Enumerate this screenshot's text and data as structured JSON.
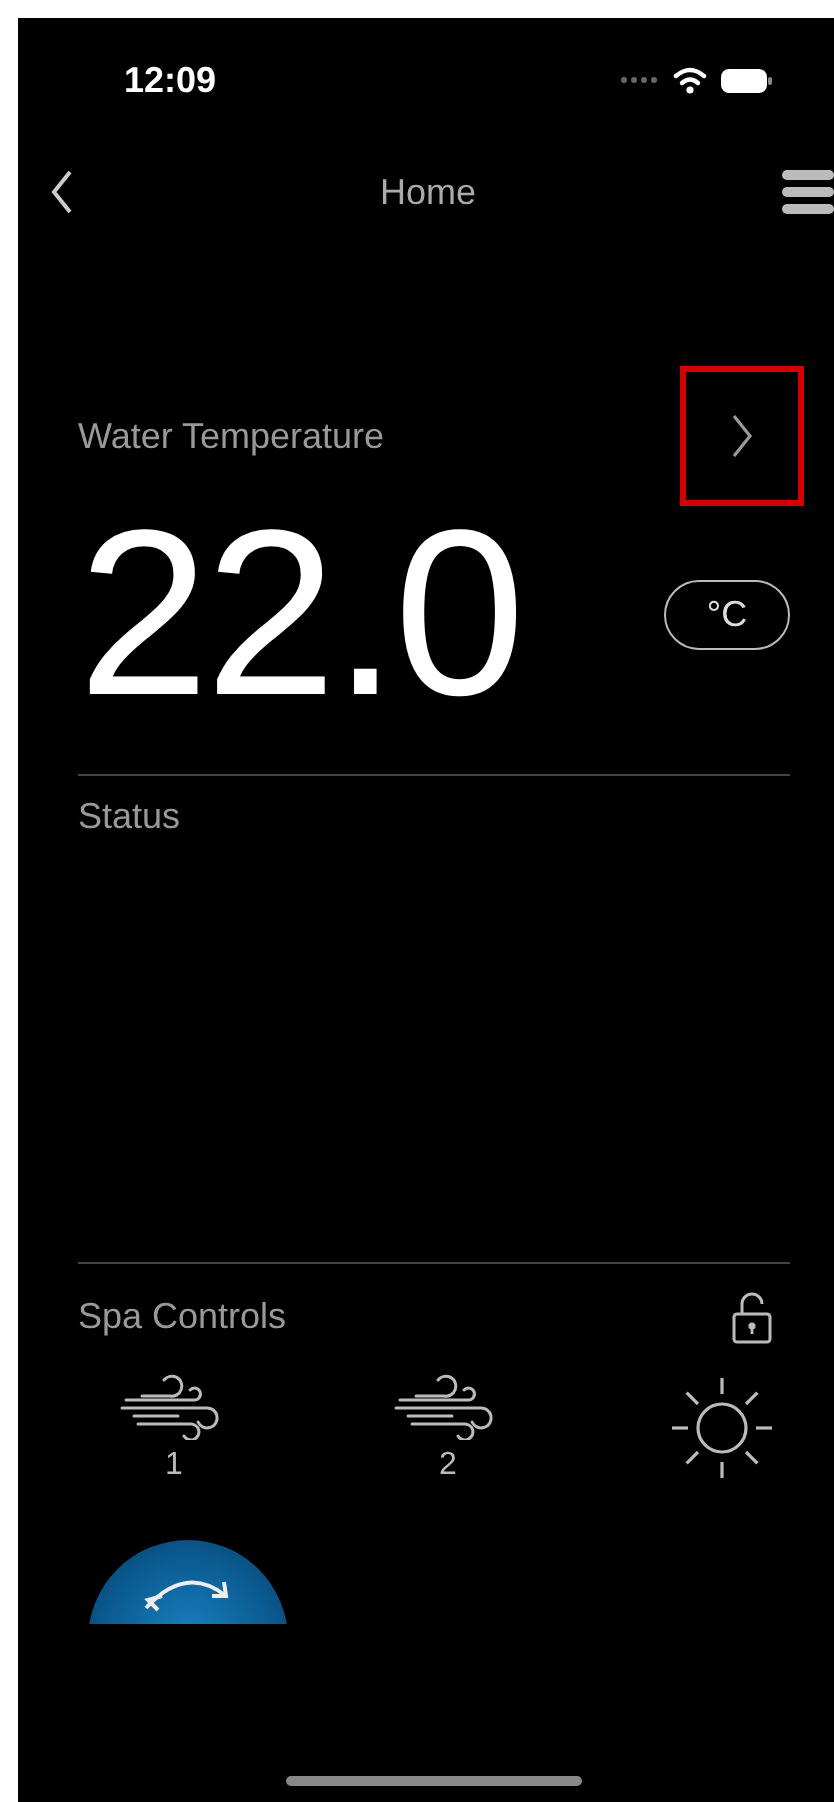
{
  "status_bar": {
    "time": "12:09"
  },
  "nav": {
    "title": "Home"
  },
  "water_temperature": {
    "label": "Water Temperature",
    "value": "22.0",
    "unit": "°C",
    "chevron_highlighted": true
  },
  "status": {
    "label": "Status"
  },
  "spa_controls": {
    "label": "Spa Controls",
    "locked": false,
    "controls": [
      {
        "kind": "jets",
        "label": "1"
      },
      {
        "kind": "jets",
        "label": "2"
      },
      {
        "kind": "light"
      }
    ]
  }
}
